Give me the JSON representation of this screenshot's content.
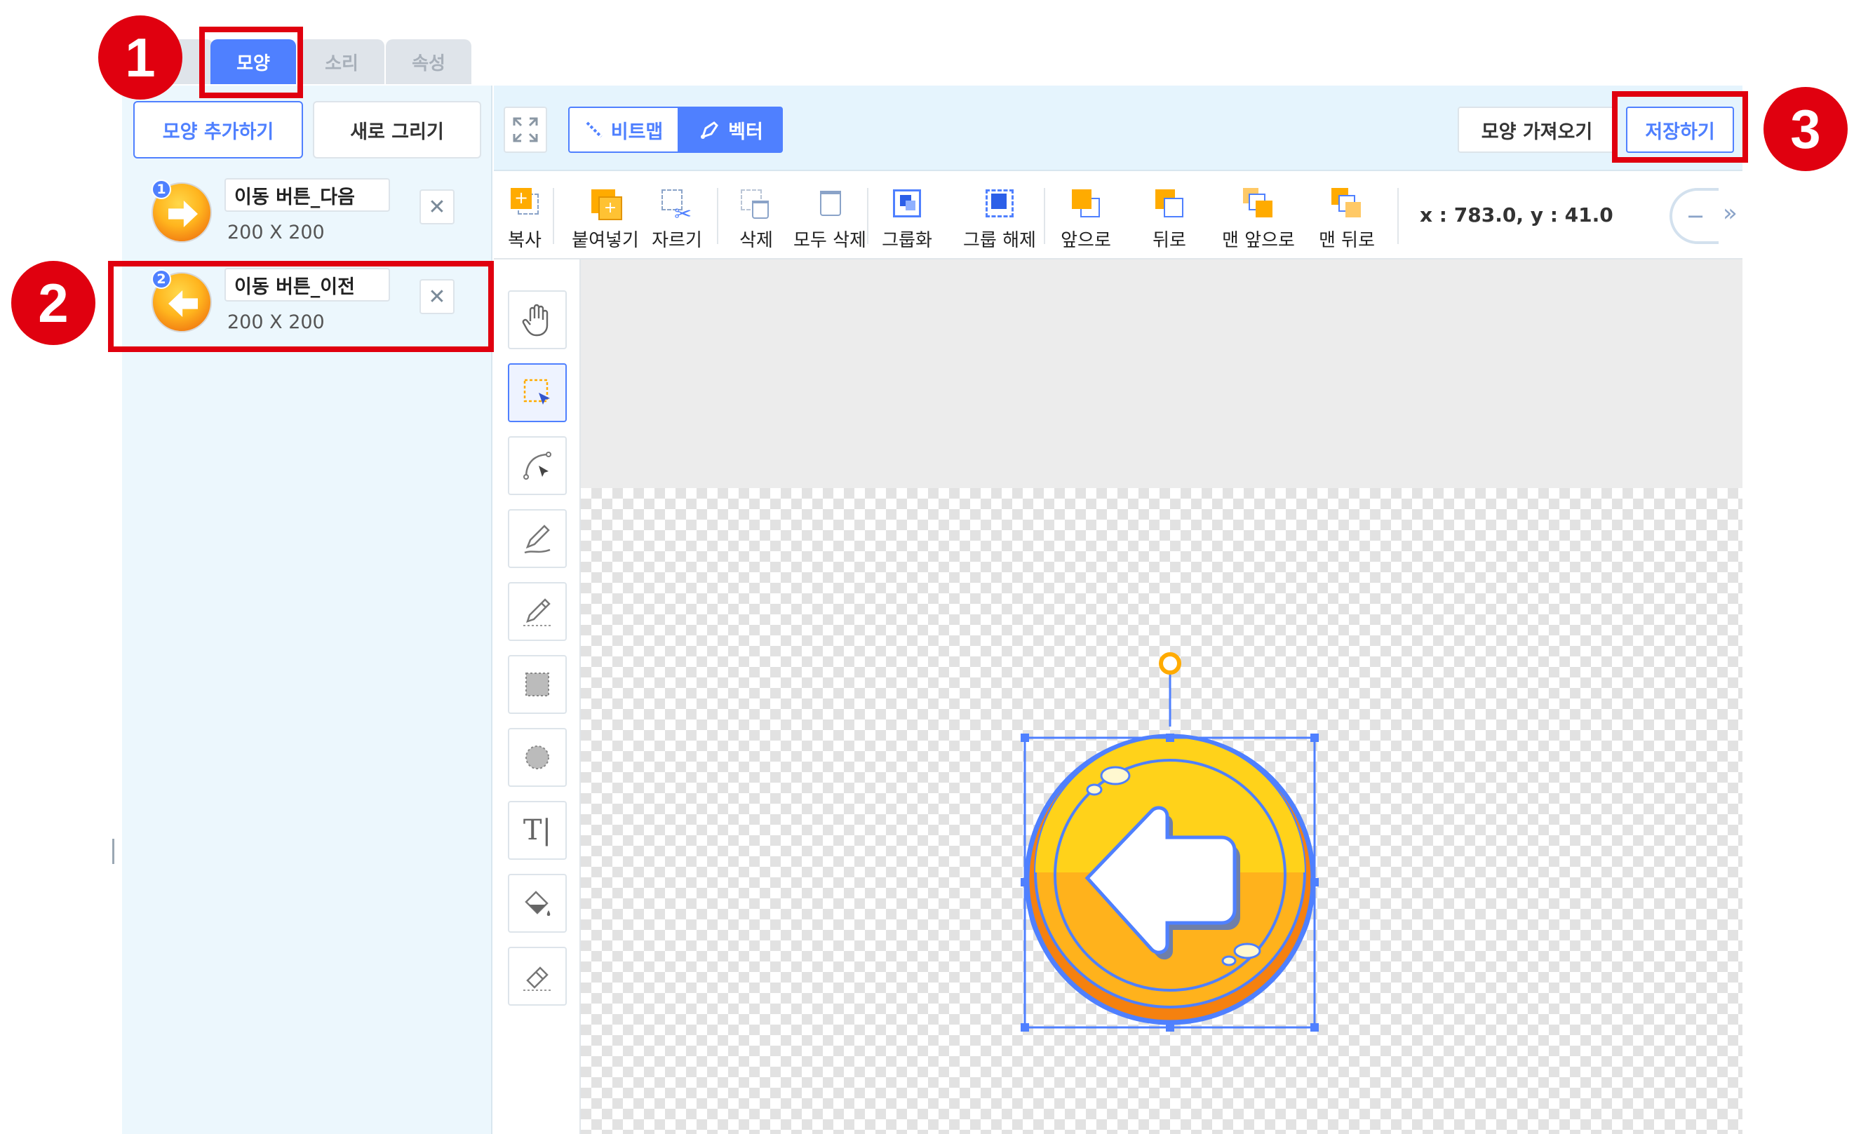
{
  "tabs": [
    {
      "label": "모양",
      "active": true
    },
    {
      "label": "소리",
      "active": false
    },
    {
      "label": "속성",
      "active": false
    }
  ],
  "left_panel": {
    "add_shape_label": "모양 추가하기",
    "new_draw_label": "새로 그리기",
    "items": [
      {
        "number": "1",
        "name": "이동 버튼_다음",
        "size": "200 X 200",
        "arrow": "right"
      },
      {
        "number": "2",
        "name": "이동 버튼_이전",
        "size": "200 X 200",
        "arrow": "left"
      }
    ],
    "delete_symbol": "✕"
  },
  "topbar": {
    "bitmap_label": "비트맵",
    "vector_label": "벡터",
    "import_label": "모양 가져오기",
    "save_label": "저장하기"
  },
  "toolbar": {
    "copy": "복사",
    "paste": "붙여넣기",
    "cut": "자르기",
    "delete": "삭제",
    "delete_all": "모두 삭제",
    "group": "그룹화",
    "ungroup": "그룹 해제",
    "forward": "앞으로",
    "backward": "뒤로",
    "to_front": "맨 앞으로",
    "to_back": "맨 뒤로",
    "coords": "x : 783.0, y : 41.0",
    "zoom_out_symbol": "−",
    "more_symbol": "»"
  },
  "vtools": [
    "hand-icon",
    "select-icon",
    "path-edit-icon",
    "pen-icon",
    "pencil-icon",
    "rect-icon",
    "circle-icon",
    "text-icon",
    "fill-icon",
    "eraser-icon"
  ],
  "vtools_text": {
    "text_tool": "T|"
  },
  "annotations": [
    "1",
    "2",
    "3"
  ],
  "colors": {
    "accent": "#4f80ff",
    "annotation_red": "#e0000f",
    "panel_bg": "#ecf7fd",
    "toolbar_icon_orange": "#ffab00"
  }
}
